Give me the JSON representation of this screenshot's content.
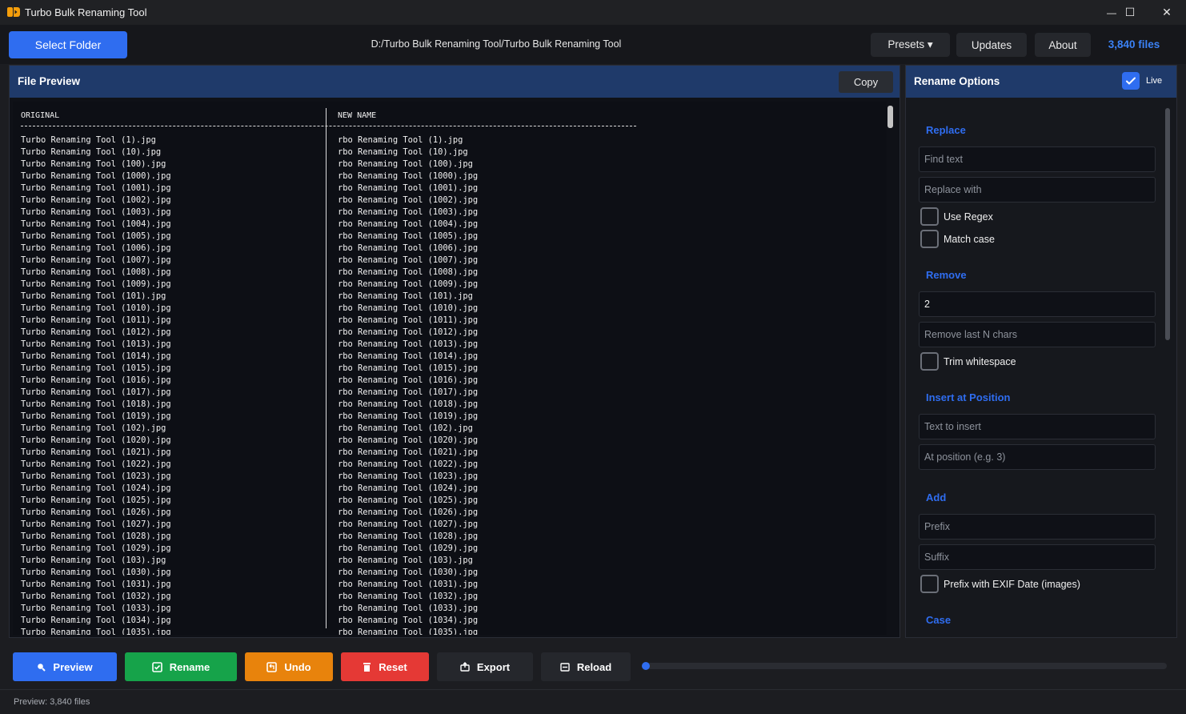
{
  "app": {
    "title": "Turbo Bulk Renaming Tool",
    "minimize": "—",
    "maximize": "☐",
    "close": "✕"
  },
  "toolbar": {
    "select_folder": "Select Folder",
    "path": "D:/Turbo Bulk Renaming Tool/Turbo Bulk Renaming Tool",
    "presets": "Presets ▾",
    "updates": "Updates",
    "about": "About",
    "file_count": "3,840 files"
  },
  "preview": {
    "title": "File Preview",
    "copy": "Copy",
    "col_original": "ORIGINAL",
    "col_new": "NEW NAME",
    "rows": [
      [
        "Turbo Renaming Tool (1).jpg",
        "rbo Renaming Tool (1).jpg"
      ],
      [
        "Turbo Renaming Tool (10).jpg",
        "rbo Renaming Tool (10).jpg"
      ],
      [
        "Turbo Renaming Tool (100).jpg",
        "rbo Renaming Tool (100).jpg"
      ],
      [
        "Turbo Renaming Tool (1000).jpg",
        "rbo Renaming Tool (1000).jpg"
      ],
      [
        "Turbo Renaming Tool (1001).jpg",
        "rbo Renaming Tool (1001).jpg"
      ],
      [
        "Turbo Renaming Tool (1002).jpg",
        "rbo Renaming Tool (1002).jpg"
      ],
      [
        "Turbo Renaming Tool (1003).jpg",
        "rbo Renaming Tool (1003).jpg"
      ],
      [
        "Turbo Renaming Tool (1004).jpg",
        "rbo Renaming Tool (1004).jpg"
      ],
      [
        "Turbo Renaming Tool (1005).jpg",
        "rbo Renaming Tool (1005).jpg"
      ],
      [
        "Turbo Renaming Tool (1006).jpg",
        "rbo Renaming Tool (1006).jpg"
      ],
      [
        "Turbo Renaming Tool (1007).jpg",
        "rbo Renaming Tool (1007).jpg"
      ],
      [
        "Turbo Renaming Tool (1008).jpg",
        "rbo Renaming Tool (1008).jpg"
      ],
      [
        "Turbo Renaming Tool (1009).jpg",
        "rbo Renaming Tool (1009).jpg"
      ],
      [
        "Turbo Renaming Tool (101).jpg",
        "rbo Renaming Tool (101).jpg"
      ],
      [
        "Turbo Renaming Tool (1010).jpg",
        "rbo Renaming Tool (1010).jpg"
      ],
      [
        "Turbo Renaming Tool (1011).jpg",
        "rbo Renaming Tool (1011).jpg"
      ],
      [
        "Turbo Renaming Tool (1012).jpg",
        "rbo Renaming Tool (1012).jpg"
      ],
      [
        "Turbo Renaming Tool (1013).jpg",
        "rbo Renaming Tool (1013).jpg"
      ],
      [
        "Turbo Renaming Tool (1014).jpg",
        "rbo Renaming Tool (1014).jpg"
      ],
      [
        "Turbo Renaming Tool (1015).jpg",
        "rbo Renaming Tool (1015).jpg"
      ],
      [
        "Turbo Renaming Tool (1016).jpg",
        "rbo Renaming Tool (1016).jpg"
      ],
      [
        "Turbo Renaming Tool (1017).jpg",
        "rbo Renaming Tool (1017).jpg"
      ],
      [
        "Turbo Renaming Tool (1018).jpg",
        "rbo Renaming Tool (1018).jpg"
      ],
      [
        "Turbo Renaming Tool (1019).jpg",
        "rbo Renaming Tool (1019).jpg"
      ],
      [
        "Turbo Renaming Tool (102).jpg",
        "rbo Renaming Tool (102).jpg"
      ],
      [
        "Turbo Renaming Tool (1020).jpg",
        "rbo Renaming Tool (1020).jpg"
      ],
      [
        "Turbo Renaming Tool (1021).jpg",
        "rbo Renaming Tool (1021).jpg"
      ],
      [
        "Turbo Renaming Tool (1022).jpg",
        "rbo Renaming Tool (1022).jpg"
      ],
      [
        "Turbo Renaming Tool (1023).jpg",
        "rbo Renaming Tool (1023).jpg"
      ],
      [
        "Turbo Renaming Tool (1024).jpg",
        "rbo Renaming Tool (1024).jpg"
      ],
      [
        "Turbo Renaming Tool (1025).jpg",
        "rbo Renaming Tool (1025).jpg"
      ],
      [
        "Turbo Renaming Tool (1026).jpg",
        "rbo Renaming Tool (1026).jpg"
      ],
      [
        "Turbo Renaming Tool (1027).jpg",
        "rbo Renaming Tool (1027).jpg"
      ],
      [
        "Turbo Renaming Tool (1028).jpg",
        "rbo Renaming Tool (1028).jpg"
      ],
      [
        "Turbo Renaming Tool (1029).jpg",
        "rbo Renaming Tool (1029).jpg"
      ],
      [
        "Turbo Renaming Tool (103).jpg",
        "rbo Renaming Tool (103).jpg"
      ],
      [
        "Turbo Renaming Tool (1030).jpg",
        "rbo Renaming Tool (1030).jpg"
      ],
      [
        "Turbo Renaming Tool (1031).jpg",
        "rbo Renaming Tool (1031).jpg"
      ],
      [
        "Turbo Renaming Tool (1032).jpg",
        "rbo Renaming Tool (1032).jpg"
      ],
      [
        "Turbo Renaming Tool (1033).jpg",
        "rbo Renaming Tool (1033).jpg"
      ],
      [
        "Turbo Renaming Tool (1034).jpg",
        "rbo Renaming Tool (1034).jpg"
      ],
      [
        "Turbo Renaming Tool (1035).jpg",
        "rbo Renaming Tool (1035).jpg"
      ]
    ]
  },
  "options": {
    "title": "Rename Options",
    "live_label": "Live",
    "live_checked": true,
    "replace": {
      "heading": "Replace",
      "find_placeholder": "Find text",
      "replace_placeholder": "Replace with",
      "use_regex": "Use Regex",
      "match_case": "Match case"
    },
    "remove": {
      "heading": "Remove",
      "first_value": "2",
      "last_placeholder": "Remove last N chars",
      "trim": "Trim whitespace"
    },
    "insert": {
      "heading": "Insert at Position",
      "text_placeholder": "Text to insert",
      "position_placeholder": "At position (e.g. 3)"
    },
    "add": {
      "heading": "Add",
      "prefix_placeholder": "Prefix",
      "suffix_placeholder": "Suffix",
      "exif": "Prefix with EXIF Date (images)"
    },
    "case": {
      "heading": "Case"
    }
  },
  "actions": {
    "preview": "Preview",
    "rename": "Rename",
    "undo": "Undo",
    "reset": "Reset",
    "export": "Export",
    "reload": "Reload",
    "progress": 0
  },
  "colors": {
    "accent": "#2f6df0",
    "preview_btn": "#2f6df0",
    "rename_btn": "#16a34a",
    "undo_btn": "#e8830c",
    "reset_btn": "#e53935",
    "neutral_btn": "#25272c"
  },
  "status": {
    "text": "Preview: 3,840 files"
  }
}
